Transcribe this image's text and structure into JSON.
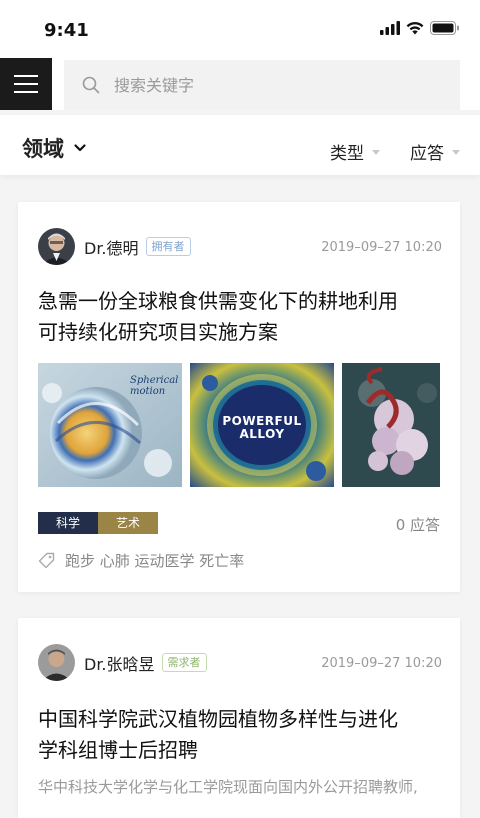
{
  "status": {
    "time": "9:41"
  },
  "search": {
    "placeholder": "搜索关键字"
  },
  "filters": {
    "field_label": "领域",
    "type_label": "类型",
    "answer_label": "应答"
  },
  "posts": [
    {
      "author": "Dr.德明",
      "role": "拥有者",
      "time": "2019–09–27 10:20",
      "title_line1": "急需一份全球粮食供需变化下的耕地利用",
      "title_line2": "可持续化研究项目实施方案",
      "images": [
        {
          "caption_line1": "Spherical",
          "caption_line2": "motion"
        },
        {
          "caption_line1": "POWERFUL",
          "caption_line2": "ALLOY"
        },
        {
          "caption_line1": "",
          "caption_line2": ""
        }
      ],
      "tags": [
        "科学",
        "艺术"
      ],
      "answers": "0 应答",
      "keywords": "跑步  心肺  运动医学  死亡率"
    },
    {
      "author": "Dr.张晗昱",
      "role": "需求者",
      "time": "2019–09–27 10:20",
      "title_line1": "中国科学院武汉植物园植物多样性与进化",
      "title_line2": "学科组博士后招聘",
      "excerpt": "华中科技大学化学与化工学院现面向国内外公开招聘教师,"
    }
  ],
  "colors": {
    "tag_science": "#232f4a",
    "tag_art": "#9a8446",
    "menu_bg": "#1b1b1b"
  }
}
